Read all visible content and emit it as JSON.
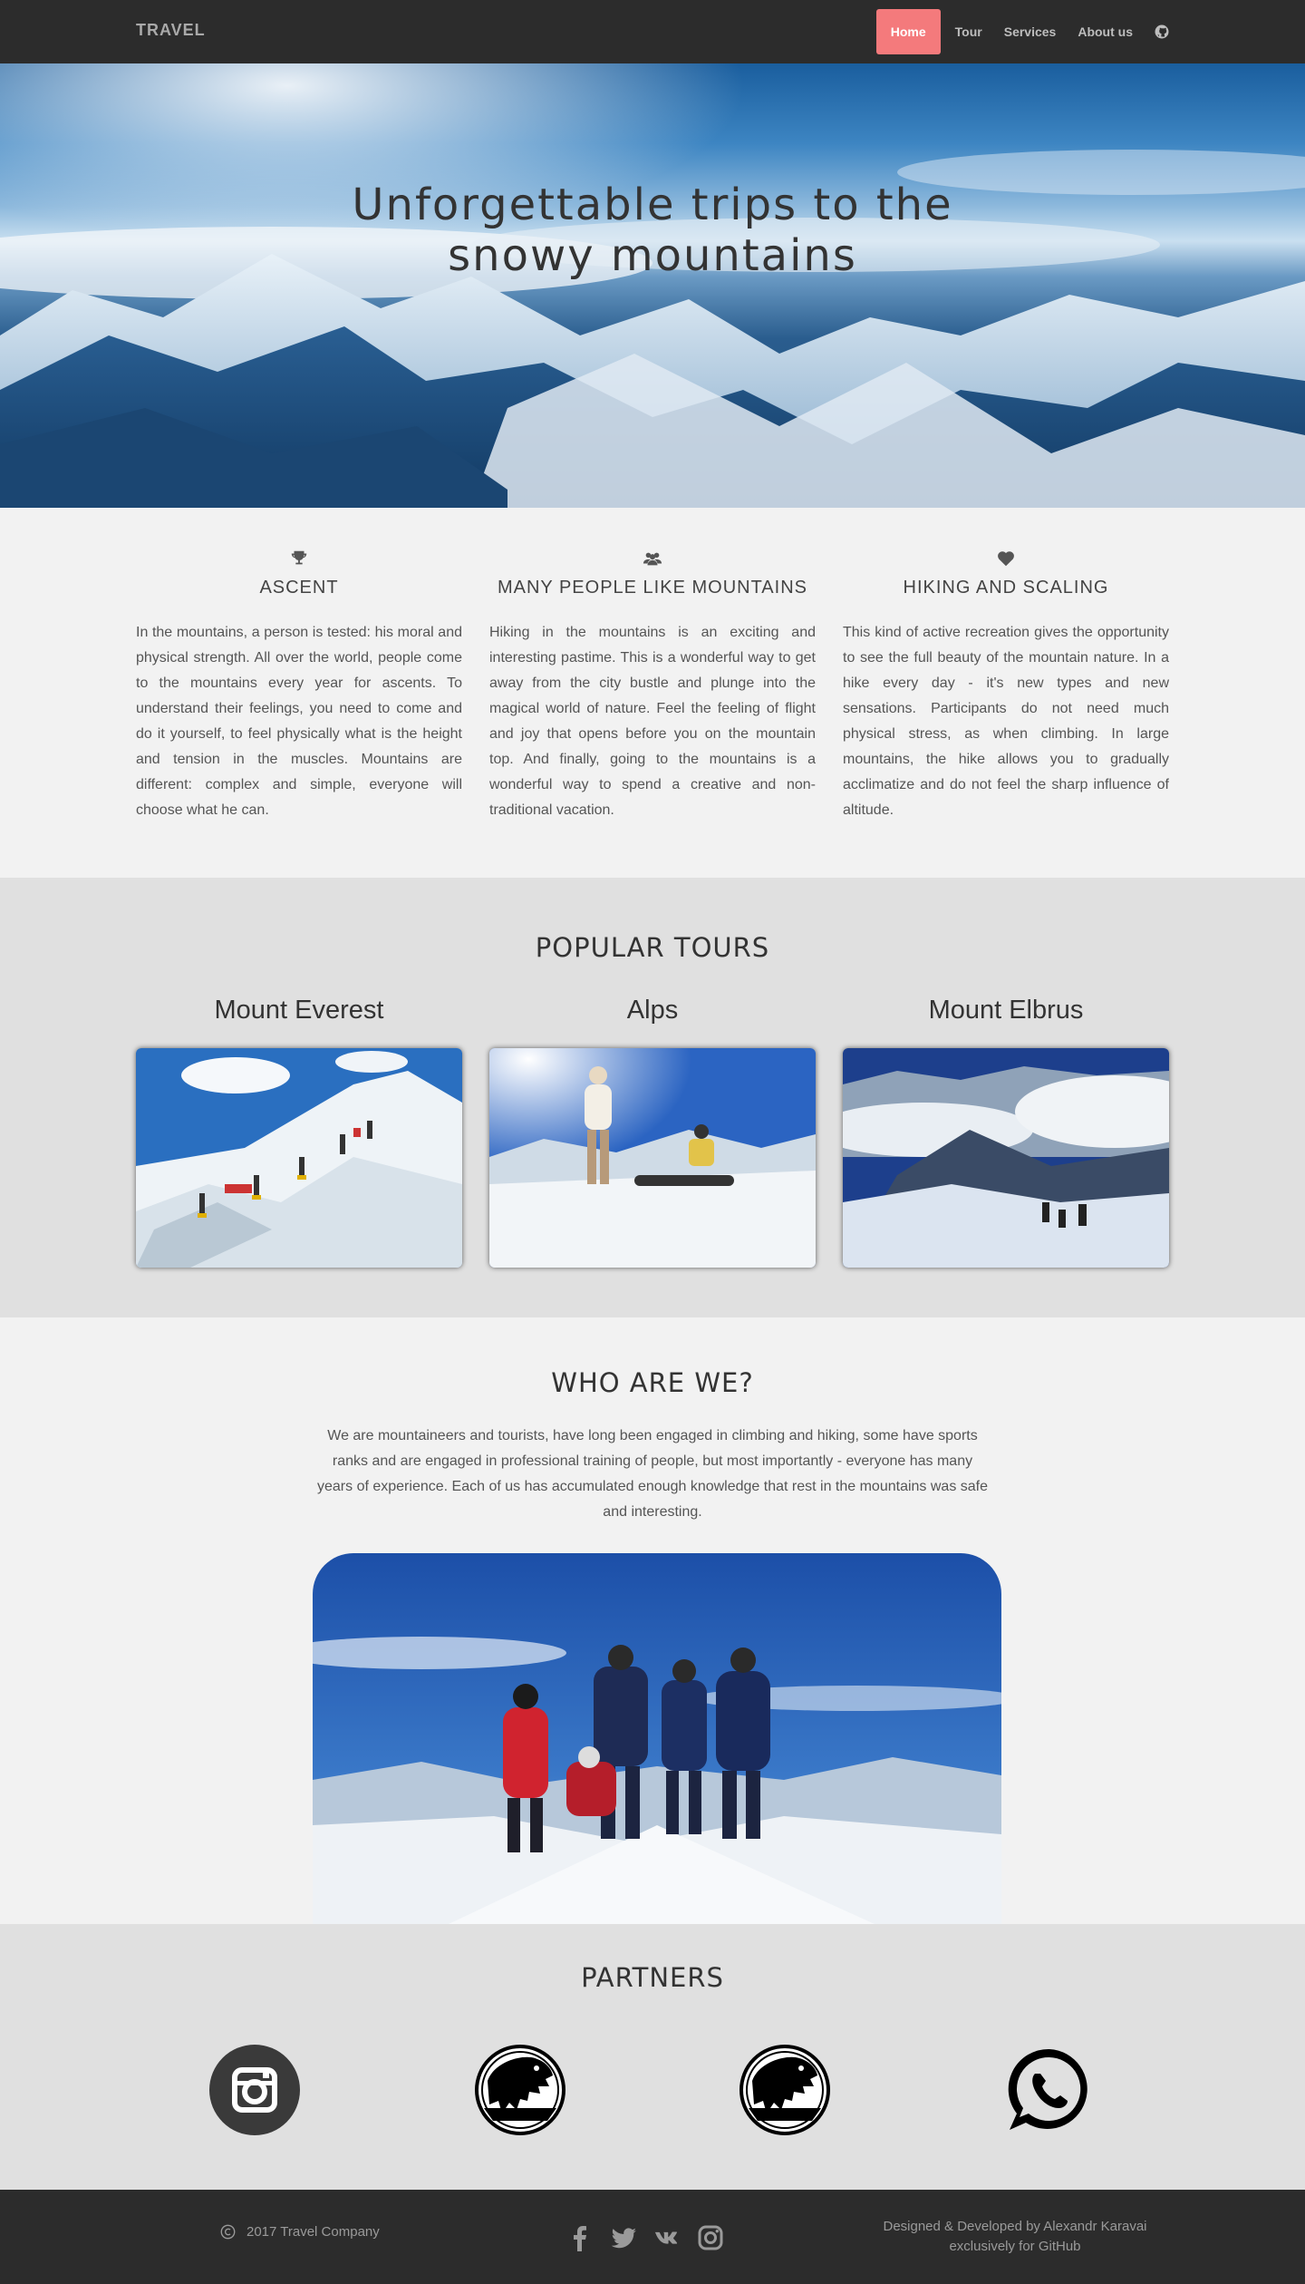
{
  "nav": {
    "brand": "TRAVEL",
    "items": [
      {
        "label": "Home",
        "active": true
      },
      {
        "label": "Tour",
        "active": false
      },
      {
        "label": "Services",
        "active": false
      },
      {
        "label": "About us",
        "active": false
      }
    ],
    "github_icon": "github-icon"
  },
  "hero": {
    "title_line1": "Unforgettable trips to the",
    "title_line2": "snowy mountains"
  },
  "features": [
    {
      "icon": "trophy-icon",
      "title": "ASCENT",
      "text": "In the mountains, a person is tested: his moral and physical strength. All over the world, people come to the mountains every year for ascents. To understand their feelings, you need to come and do it yourself, to feel physically what is the height and tension in the muscles. Mountains are different: complex and simple, everyone will choose what he can."
    },
    {
      "icon": "users-icon",
      "title": "MANY PEOPLE LIKE MOUNTAINS",
      "text": "Hiking in the mountains is an exciting and interesting pastime. This is a wonderful way to get away from the city bustle and plunge into the magical world of nature. Feel the feeling of flight and joy that opens before you on the mountain top. And finally, going to the mountains is a wonderful way to spend a creative and non-traditional vacation."
    },
    {
      "icon": "heart-icon",
      "title": "HIKING AND SCALING",
      "text": "This kind of active recreation gives the opportunity to see the full beauty of the mountain nature. In a hike every day - it's new types and new sensations. Participants do not need much physical stress, as when climbing. In large mountains, the hike allows you to gradually acclimatize and do not feel the sharp influence of altitude."
    }
  ],
  "tours": {
    "title": "POPULAR TOURS",
    "items": [
      {
        "name": "Mount Everest"
      },
      {
        "name": "Alps"
      },
      {
        "name": "Mount Elbrus"
      }
    ]
  },
  "who": {
    "title": "WHO ARE WE?",
    "text": "We are mountaineers and tourists, have long been engaged in climbing and hiking, some have sports ranks and are engaged in professional training of people, but most importantly - everyone has many years of experience. Each of us has accumulated enough knowledge that rest in the mountains was safe and interesting."
  },
  "partners": {
    "title": "PARTNERS",
    "logos": [
      "instagram-icon",
      "jurassic-park-logo",
      "jurassic-park-logo",
      "whatsapp-icon"
    ]
  },
  "footer": {
    "copyright": "2017 Travel Company",
    "social": [
      "facebook-icon",
      "twitter-icon",
      "vk-icon",
      "instagram-icon"
    ],
    "credit_line1": "Designed & Developed by Alexandr Karavai",
    "credit_line2": "exclusively for GitHub"
  },
  "colors": {
    "nav_bg": "#2c2c2c",
    "active": "#f47a7c",
    "section_alt": "#e0e0e0",
    "section_light": "#f2f2f2"
  }
}
